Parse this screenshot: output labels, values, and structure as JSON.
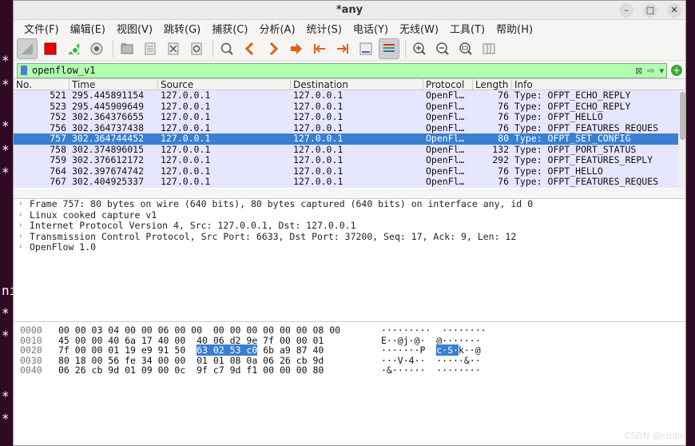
{
  "window": {
    "title": "*any"
  },
  "menu": [
    "文件(F)",
    "编辑(E)",
    "视图(V)",
    "跳转(G)",
    "捕获(C)",
    "分析(A)",
    "统计(S)",
    "电话(Y)",
    "无线(W)",
    "工具(T)",
    "帮助(H)"
  ],
  "filter": {
    "value": "openflow_v1"
  },
  "columns": {
    "no": "No.",
    "time": "Time",
    "source": "Source",
    "destination": "Destination",
    "protocol": "Protocol",
    "length": "Length",
    "info": "Info"
  },
  "packets": [
    {
      "no": "521",
      "time": "295.445891154",
      "src": "127.0.0.1",
      "dst": "127.0.0.1",
      "proto": "OpenFl…",
      "len": "76",
      "info": "Type: OFPT_ECHO_REPLY"
    },
    {
      "no": "523",
      "time": "295.445909649",
      "src": "127.0.0.1",
      "dst": "127.0.0.1",
      "proto": "OpenFl…",
      "len": "76",
      "info": "Type: OFPT_ECHO_REPLY"
    },
    {
      "no": "752",
      "time": "302.364376655",
      "src": "127.0.0.1",
      "dst": "127.0.0.1",
      "proto": "OpenFl…",
      "len": "76",
      "info": "Type: OFPT_HELLO"
    },
    {
      "no": "756",
      "time": "302.364737438",
      "src": "127.0.0.1",
      "dst": "127.0.0.1",
      "proto": "OpenFl…",
      "len": "76",
      "info": "Type: OFPT_FEATURES_REQUES"
    },
    {
      "no": "757",
      "time": "302.364744452",
      "src": "127.0.0.1",
      "dst": "127.0.0.1",
      "proto": "OpenFl…",
      "len": "80",
      "info": "Type: OFPT_SET_CONFIG"
    },
    {
      "no": "758",
      "time": "302.374896015",
      "src": "127.0.0.1",
      "dst": "127.0.0.1",
      "proto": "OpenFl…",
      "len": "132",
      "info": "Type: OFPT_PORT_STATUS"
    },
    {
      "no": "759",
      "time": "302.376612172",
      "src": "127.0.0.1",
      "dst": "127.0.0.1",
      "proto": "OpenFl…",
      "len": "292",
      "info": "Type: OFPT_FEATURES_REPLY"
    },
    {
      "no": "764",
      "time": "302.397674742",
      "src": "127.0.0.1",
      "dst": "127.0.0.1",
      "proto": "OpenFl…",
      "len": "76",
      "info": "Type: OFPT_HELLO"
    },
    {
      "no": "767",
      "time": "302.404925337",
      "src": "127.0.0.1",
      "dst": "127.0.0.1",
      "proto": "OpenFl…",
      "len": "76",
      "info": "Type: OFPT_FEATURES_REQUES"
    }
  ],
  "details": [
    "Frame 757: 80 bytes on wire (640 bits), 80 bytes captured (640 bits) on interface any, id 0",
    "Linux cooked capture v1",
    "Internet Protocol Version 4, Src: 127.0.0.1, Dst: 127.0.0.1",
    "Transmission Control Protocol, Src Port: 6633, Dst Port: 37200, Seq: 17, Ack: 9, Len: 12",
    "OpenFlow 1.0"
  ],
  "hex": [
    {
      "off": "0000",
      "pre": "00 00 03 04 00 00 06 00 00  00 00 00 00 00 00 08 00",
      "hl": "",
      "post": "",
      "apre": "·········  ········",
      "ahl": "",
      "apost": ""
    },
    {
      "off": "0010",
      "pre": "45 00 00 40 6a 17 40 00  40 06 d2 9e 7f 00 00 01",
      "hl": "",
      "post": "",
      "apre": "E··@j·@·  @·······",
      "ahl": "",
      "apost": ""
    },
    {
      "off": "0020",
      "pre": "7f 00 00 01 19 e9 91 50  ",
      "hl": "63 02 53 c0",
      "post": " 6b a9 87 40",
      "apre": "·······P  ",
      "ahl": "c·S·",
      "apost": "k··@"
    },
    {
      "off": "0030",
      "pre": "80 18 00 56 fe 34 00 00  01 01 08 0a 06 26 cb 9d",
      "hl": "",
      "post": "",
      "apre": "···V·4··  ·····&··",
      "ahl": "",
      "apost": ""
    },
    {
      "off": "0040",
      "pre": "06 26 cb 9d 01 09 00 0c  9f c7 9d f1 00 00 00 80",
      "hl": "",
      "post": "",
      "apre": "·&······  ········",
      "ahl": "",
      "apost": ""
    }
  ],
  "watermark": "CSDN @rzldin",
  "selected_index": 4
}
